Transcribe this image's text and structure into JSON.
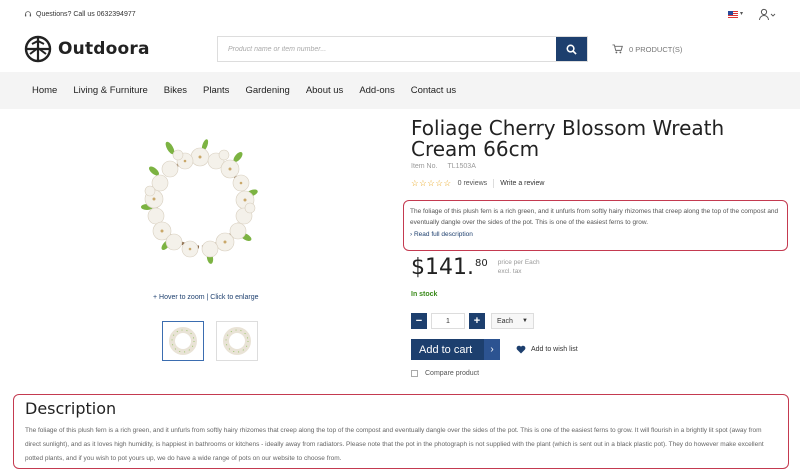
{
  "topbar": {
    "questions": "Questions? Call us 0632394977"
  },
  "header": {
    "brand": "Outdoora",
    "search_placeholder": "Product name or item number...",
    "cart_label": "0 PRODUCT(S)"
  },
  "nav": {
    "items": [
      "Home",
      "Living & Furniture",
      "Bikes",
      "Plants",
      "Gardening",
      "About us",
      "Add-ons",
      "Contact us"
    ]
  },
  "gallery": {
    "zoom_hint": "+ Hover to zoom | Click to enlarge"
  },
  "product": {
    "title": "Foliage Cherry Blossom Wreath Cream 66cm",
    "item_no_label": "Item No.",
    "item_no": "TL1503A",
    "reviews": "0 reviews",
    "write_review": "Write a review",
    "short_description": "The foliage of this plush fern is a rich green, and it unfurls from softly hairy rhizomes that creep along the top of the compost and eventually dangle over the sides of the pot. This is one of the easiest ferns to grow.",
    "read_full": "› Read full description",
    "price_main": "$141.",
    "price_cents": "80",
    "price_per": "price per Each",
    "tax_note": "excl. tax",
    "stock": "In stock",
    "quantity": "1",
    "unit": "Each",
    "add_to_cart": "Add to cart",
    "wishlist": "Add to wish list",
    "compare": "Compare product"
  },
  "description": {
    "heading": "Description",
    "text": "The foliage of this plush fern is a rich green, and it unfurls from softly hairy rhizomes that creep along the top of the compost and eventually dangle over the sides of the pot. This is one of the easiest ferns to grow. It will flourish in a brightly lit spot (away from direct sunlight), and as it loves high humidity, is happiest in bathrooms or kitchens - ideally away from radiators. Please note that the pot in the photograph is not supplied with the plant (which is sent out in a black plastic pot). They do however make excellent potted plants, and if you wish to pot yours up, we do have a wide range of pots on our website to choose from."
  },
  "colors": {
    "primary": "#1d3f6e",
    "highlight_border": "#c43a50",
    "stock_green": "#3a8a1a",
    "star": "#e8a317"
  }
}
